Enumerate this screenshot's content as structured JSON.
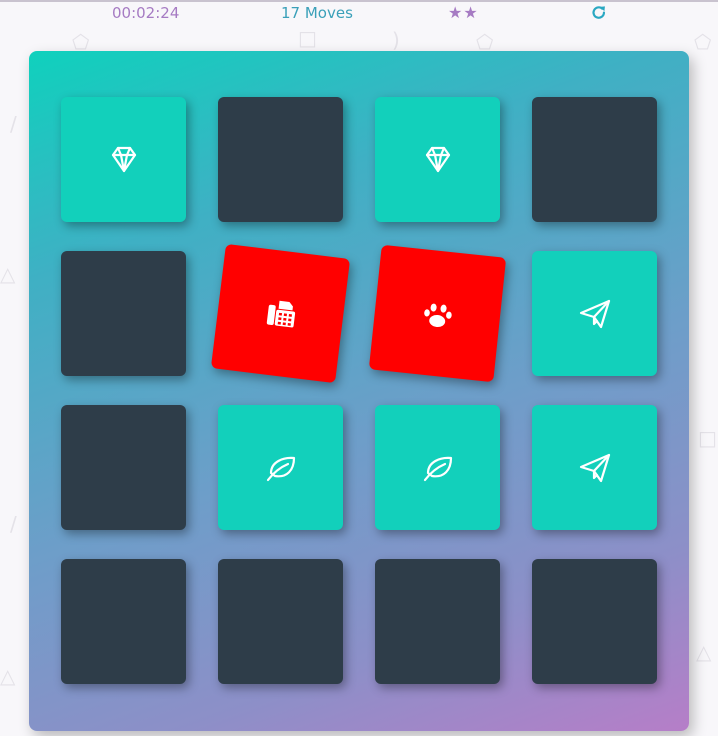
{
  "score_panel": {
    "timer": "00:02:24",
    "moves": "17 Moves",
    "stars": "★★",
    "star_rating": 2,
    "restart_icon": "restart-icon"
  },
  "colors": {
    "card_hidden": "#2e3d49",
    "card_matched": "#12d0bb",
    "card_open_mismatch": "#ff0000",
    "timer_text": "#a67bc3",
    "moves_text": "#3aa0b9"
  },
  "board": {
    "rows": [
      [
        {
          "state": "match",
          "icon": "diamond-icon"
        },
        {
          "state": "hidden",
          "icon": ""
        },
        {
          "state": "match",
          "icon": "diamond-icon"
        },
        {
          "state": "hidden",
          "icon": ""
        }
      ],
      [
        {
          "state": "hidden",
          "icon": ""
        },
        {
          "state": "open",
          "icon": "fax-icon"
        },
        {
          "state": "open",
          "icon": "paw-icon"
        },
        {
          "state": "match",
          "icon": "paper-plane-icon"
        }
      ],
      [
        {
          "state": "hidden",
          "icon": ""
        },
        {
          "state": "match",
          "icon": "leaf-icon"
        },
        {
          "state": "match",
          "icon": "leaf-icon"
        },
        {
          "state": "match",
          "icon": "paper-plane-icon"
        }
      ],
      [
        {
          "state": "hidden",
          "icon": ""
        },
        {
          "state": "hidden",
          "icon": ""
        },
        {
          "state": "hidden",
          "icon": ""
        },
        {
          "state": "hidden",
          "icon": ""
        }
      ]
    ]
  }
}
